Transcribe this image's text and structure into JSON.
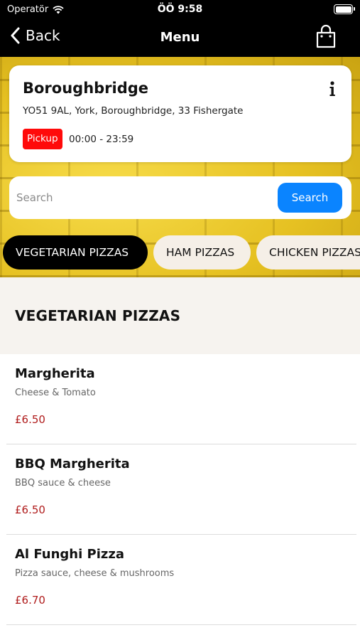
{
  "status": {
    "carrier": "Operatör",
    "time": "ÖÖ 9:58"
  },
  "nav": {
    "back_label": "Back",
    "title": "Menu"
  },
  "store": {
    "name": "Boroughbridge",
    "address": "YO51 9AL, York, Boroughbridge, 33 Fishergate",
    "pickup_label": "Pickup",
    "hours": "00:00 - 23:59"
  },
  "search": {
    "placeholder": "Search",
    "button_label": "Search"
  },
  "categories": [
    {
      "label": "VEGETARIAN PIZZAS",
      "active": true
    },
    {
      "label": "HAM PIZZAS",
      "active": false
    },
    {
      "label": "CHICKEN PIZZAS",
      "active": false
    }
  ],
  "section": {
    "title": "VEGETARIAN PIZZAS"
  },
  "items": [
    {
      "name": "Margherita",
      "description": "Cheese & Tomato",
      "price": "£6.50"
    },
    {
      "name": "BBQ Margherita",
      "description": "BBQ sauce & cheese",
      "price": "£6.50"
    },
    {
      "name": "Al Funghi Pizza",
      "description": "Pizza sauce, cheese & mushrooms",
      "price": "£6.70"
    }
  ],
  "colors": {
    "accent_blue": "#0a84ff",
    "pickup_red": "#ff0a0a",
    "price_red": "#b01c1c",
    "hero_yellow": "#e8c62a"
  }
}
